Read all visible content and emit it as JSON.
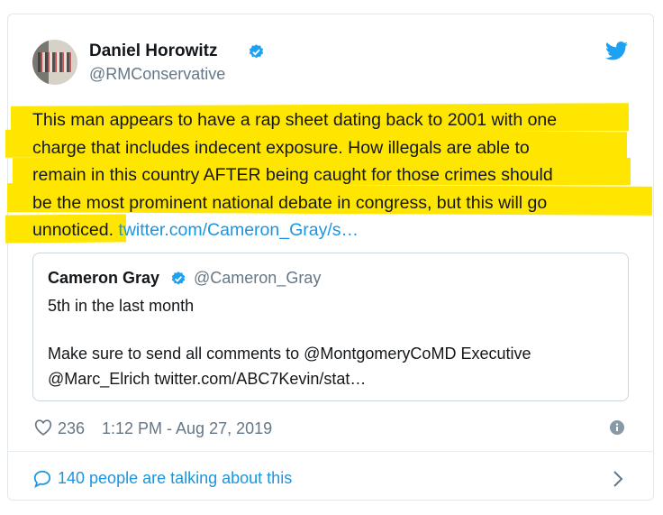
{
  "author": {
    "name": "Daniel Horowitz",
    "handle": "@RMConservative"
  },
  "tweet": {
    "lines": [
      "This man appears to have a rap sheet dating back to 2001 with one",
      "charge that includes indecent exposure. How illegals are able to",
      "remain in this country AFTER being caught for those crimes should",
      "be the most prominent national debate in congress, but this will go",
      "unnoticed."
    ],
    "link_text": "twitter.com/Cameron_Gray/s…"
  },
  "quoted": {
    "name": "Cameron Gray",
    "handle": "@Cameron_Gray",
    "line1": "5th in the last month",
    "line2": "Make sure to send all comments to @MontgomeryCoMD Executive",
    "line3": "@Marc_Elrich twitter.com/ABC7Kevin/stat…"
  },
  "footer": {
    "likes": "236",
    "timestamp": "1:12 PM - Aug 27, 2019",
    "talking": "140 people are talking about this"
  },
  "colors": {
    "highlight": "#ffe600",
    "link": "#1b95e0",
    "verified": "#1da1f2"
  },
  "icons": [
    "verified-badge-icon",
    "twitter-bird-icon",
    "heart-icon",
    "info-icon",
    "speech-bubble-icon",
    "chevron-right-icon"
  ]
}
